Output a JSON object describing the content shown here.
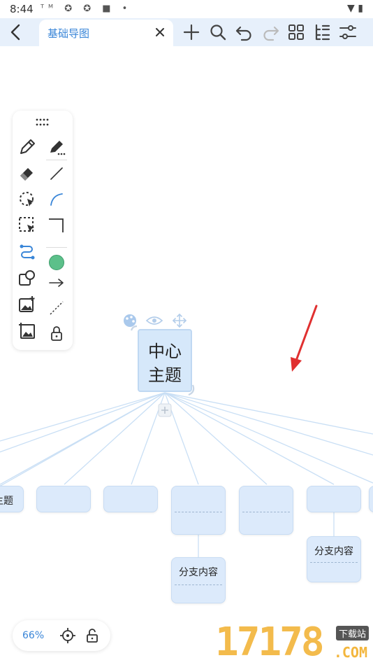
{
  "status": {
    "time": "8:44",
    "icons": [
      "tm-icon",
      "app-icon",
      "app-icon",
      "app-icon",
      "dot-icon"
    ],
    "right_icons": [
      "wifi-icon",
      "battery-icon"
    ]
  },
  "toolbar": {
    "tab_title": "基础导图",
    "tools": [
      "add-icon",
      "search-icon",
      "undo-icon",
      "redo-icon",
      "layout-grid-icon",
      "outline-icon",
      "settings-sliders-icon"
    ]
  },
  "palette": {
    "color_swatch": "#5cc08a",
    "tools": [
      "pen-icon",
      "marker-pen-icon",
      "eraser-icon",
      "line-icon",
      "lasso-icon",
      "arc-icon",
      "select-rect-icon",
      "corner-line-icon",
      "connector-icon",
      "color-swatch",
      "shape-icon",
      "arrow-icon",
      "image-add-icon",
      "dashed-line-icon",
      "image-frame-icon",
      "lock-icon"
    ]
  },
  "mindmap": {
    "central_line1": "中心",
    "central_line2": "主题",
    "branch_partial": "主题",
    "sub_topic_1": "分支内容",
    "sub_topic_2": "分支内容"
  },
  "footer": {
    "zoom": "66%"
  },
  "colors": {
    "accent": "#3a86d8",
    "node_fill": "#dceafb",
    "line": "#c9dff5",
    "annotation_arrow": "#e03030"
  },
  "watermark": {
    "digits": "17178",
    "tag": "下载站",
    "domain": ".COM"
  }
}
